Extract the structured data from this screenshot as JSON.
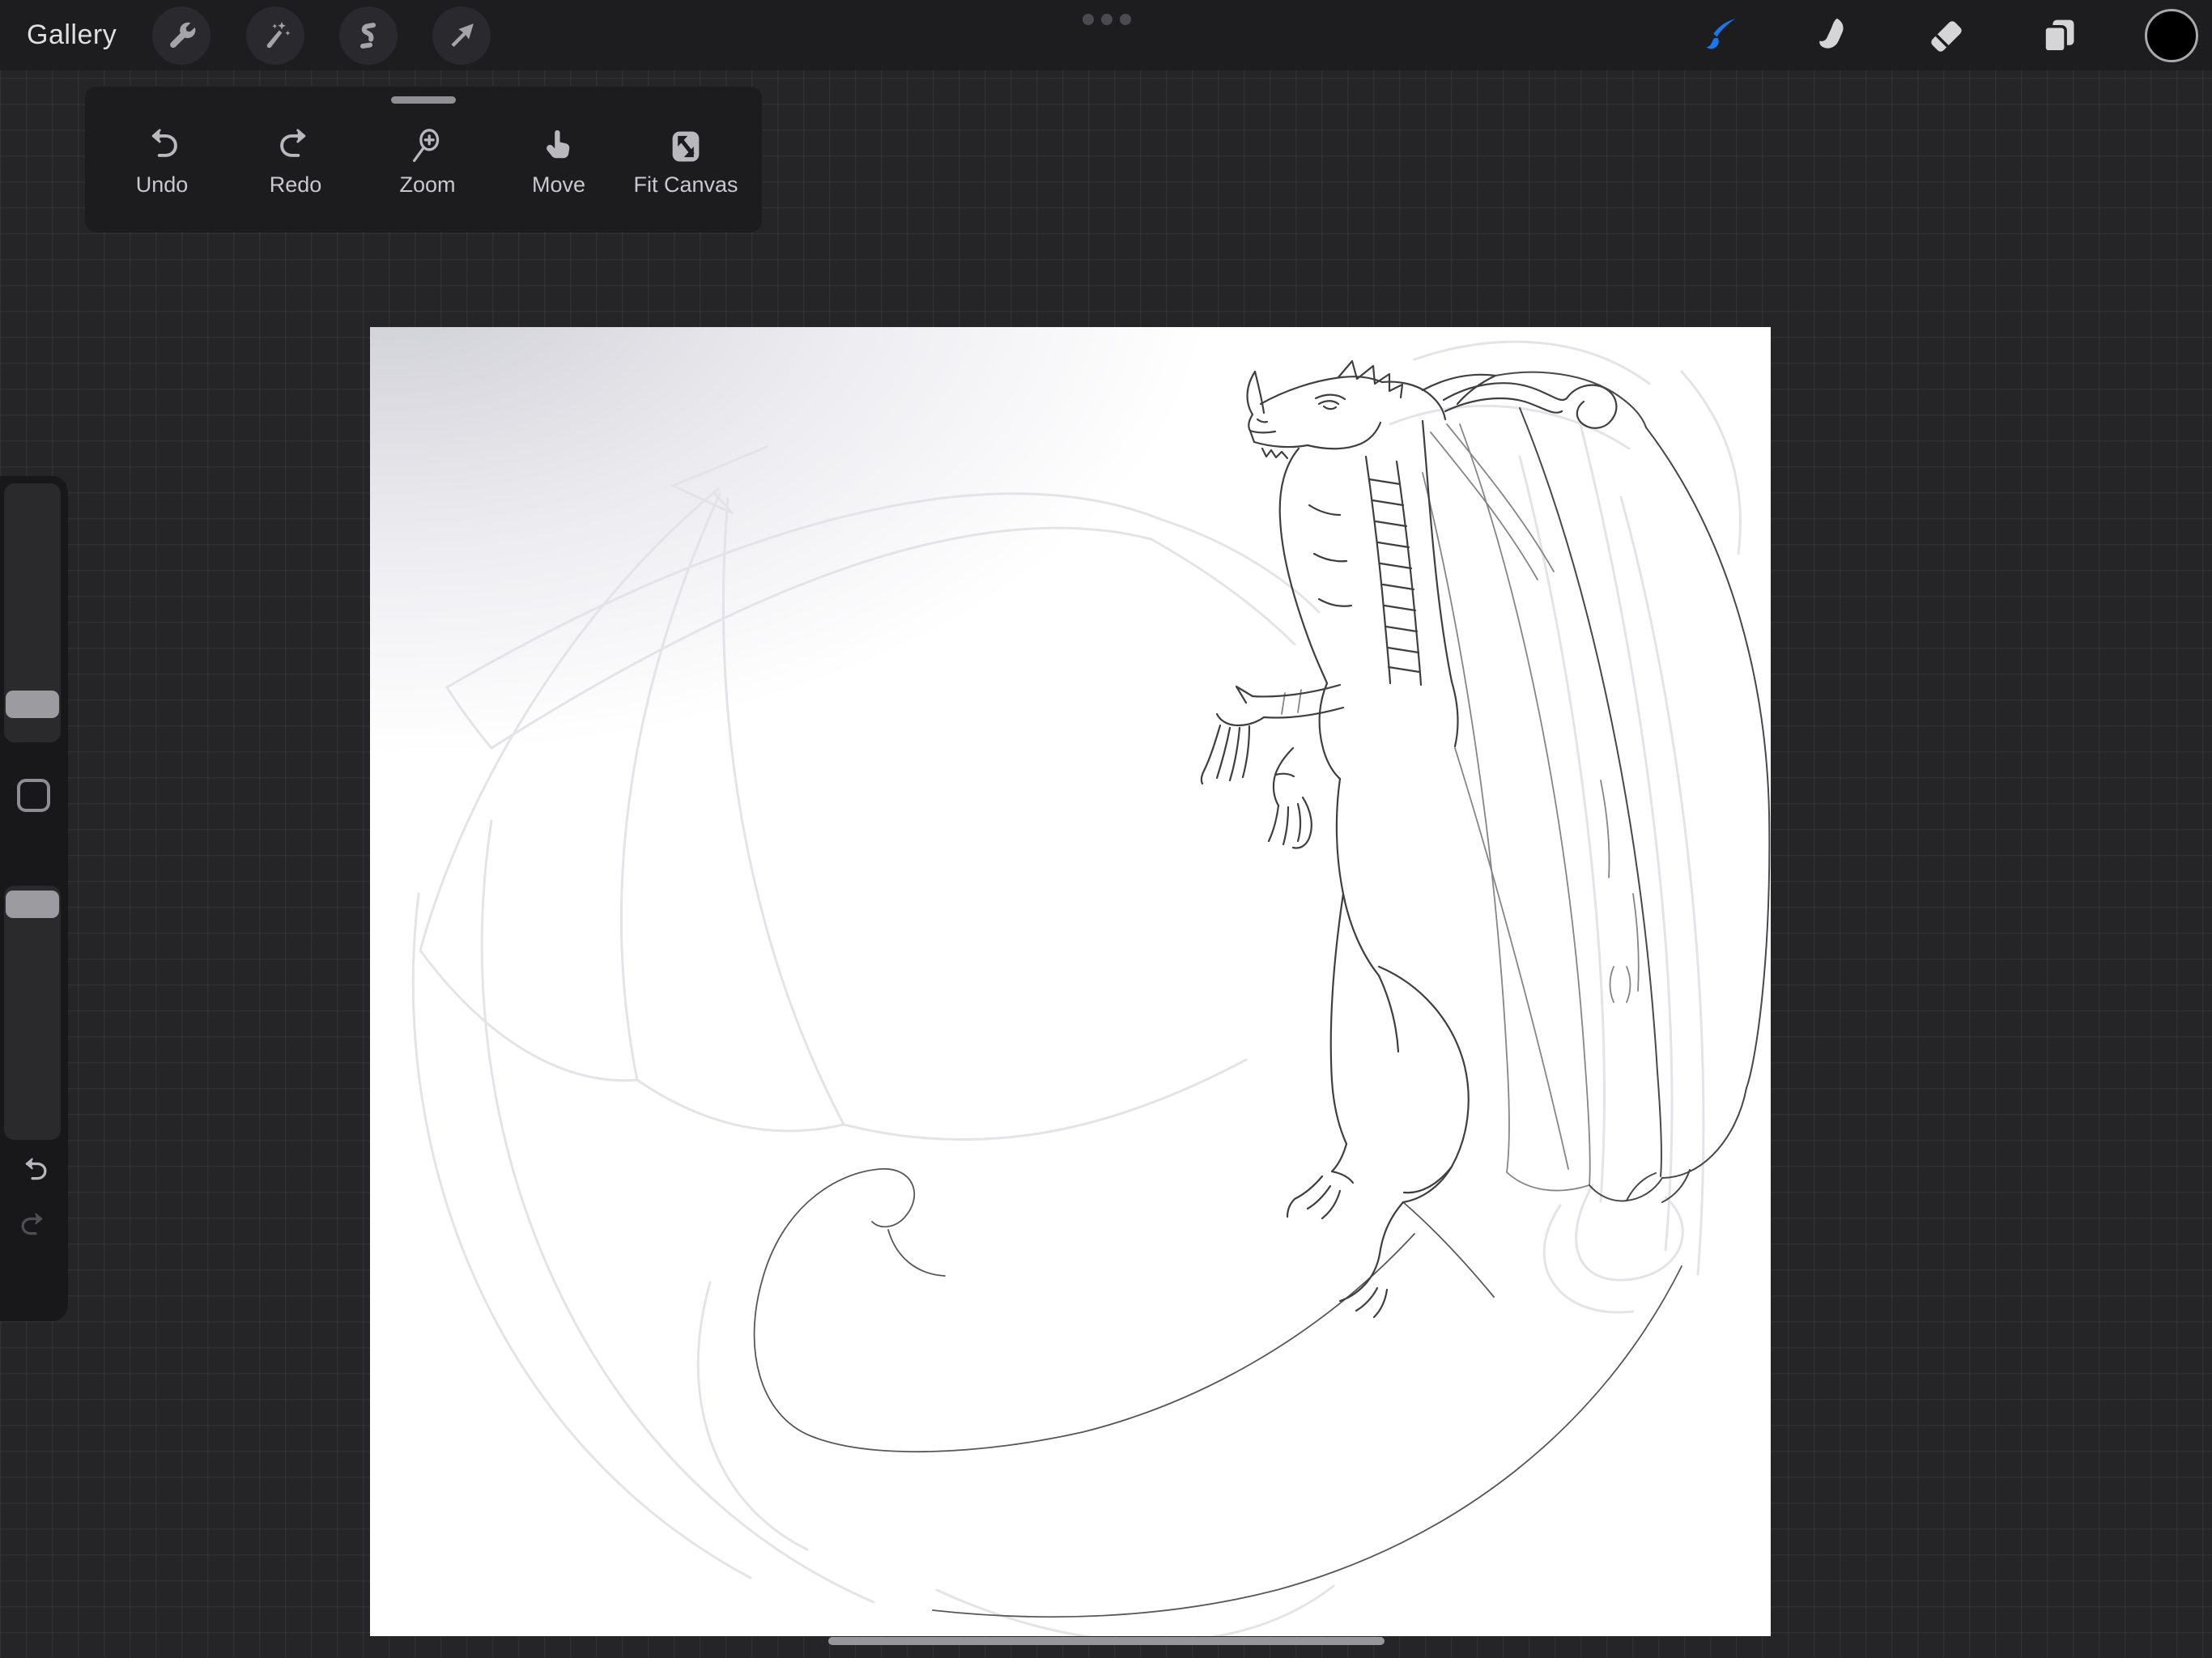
{
  "top_bar": {
    "gallery_label": "Gallery",
    "overflow_icon": "ellipsis-icon",
    "left_tools": [
      {
        "name": "actions",
        "icon": "wrench-icon"
      },
      {
        "name": "adjustments",
        "icon": "magic-wand-icon"
      },
      {
        "name": "selection",
        "icon": "selection-s-icon"
      },
      {
        "name": "transform",
        "icon": "transform-arrow-icon"
      }
    ],
    "right_tools": [
      {
        "name": "paint",
        "icon": "paintbrush-icon",
        "active": true
      },
      {
        "name": "smudge",
        "icon": "smudge-finger-icon",
        "active": false
      },
      {
        "name": "erase",
        "icon": "eraser-icon",
        "active": false
      },
      {
        "name": "layers",
        "icon": "layers-icon",
        "active": false
      },
      {
        "name": "color",
        "icon": "color-swatch-circle",
        "swatch_color": "#000000"
      }
    ]
  },
  "quick_toolbar": {
    "handle_icon": "drag-handle",
    "buttons": [
      {
        "label": "Undo",
        "icon": "undo-icon"
      },
      {
        "label": "Redo",
        "icon": "redo-icon"
      },
      {
        "label": "Zoom",
        "icon": "zoom-magnifier-icon"
      },
      {
        "label": "Move",
        "icon": "move-hand-icon"
      },
      {
        "label": "Fit Canvas",
        "icon": "fit-canvas-icon"
      }
    ]
  },
  "sidebar": {
    "brush_size_slider": {
      "icon": "slider-track",
      "thumb_position": "near-bottom"
    },
    "modify_button": {
      "icon": "square-outline-icon"
    },
    "opacity_slider": {
      "icon": "slider-track",
      "thumb_position": "near-top"
    },
    "undo_button": {
      "icon": "undo-arrow-icon",
      "enabled": true
    },
    "redo_button": {
      "icon": "redo-arrow-icon",
      "enabled": false
    }
  },
  "canvas": {
    "background": "#ffffff",
    "artwork": "line sketch of a dragon facing left: horned head with curled horn, segmented neck, clawed hands, draped right wing, faint unfinished left wing and a long spiraling tail, soft gray shading in top-left corner"
  },
  "home_indicator_icon": "home-indicator-bar",
  "colors": {
    "accent_blue": "#1678f2",
    "app_background": "#252528",
    "panel": "#1d1d20",
    "sidebar_panel": "#18181a",
    "canvas_white": "#ffffff",
    "color_swatch": "#000000"
  }
}
